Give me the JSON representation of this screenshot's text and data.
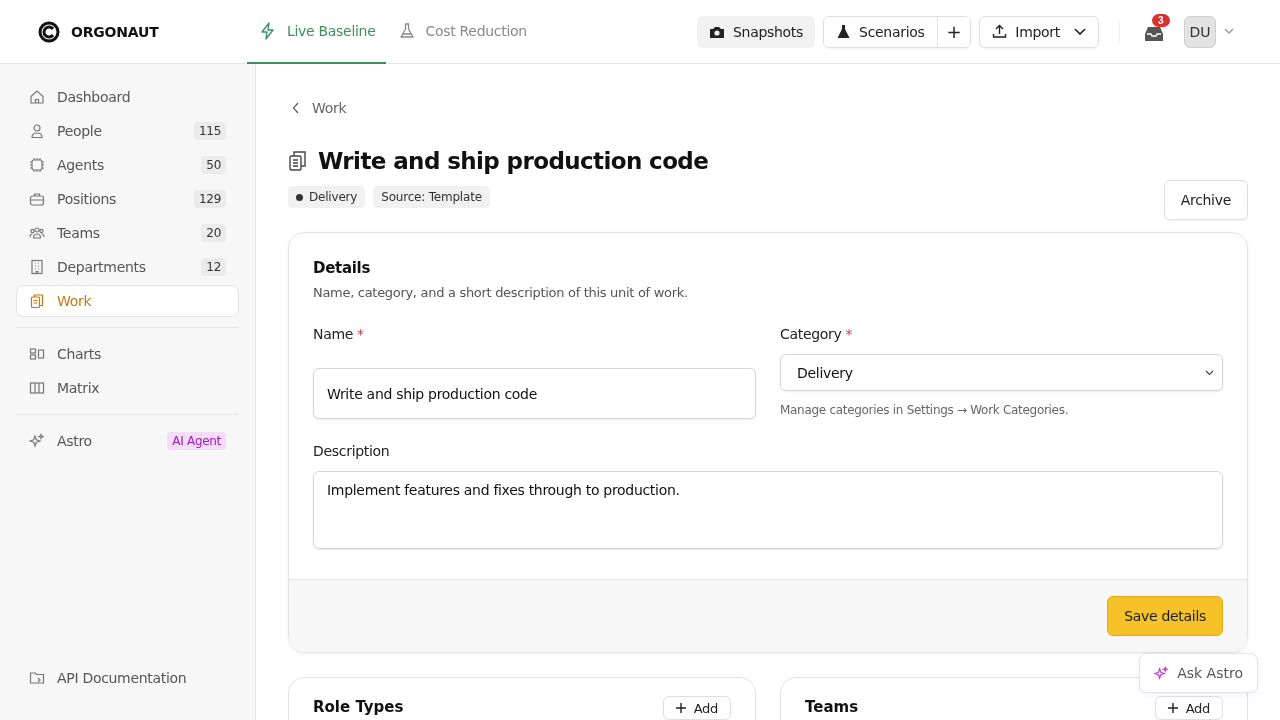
{
  "brand": {
    "name": "ORGONAUT"
  },
  "tabs": [
    {
      "label": "Live Baseline",
      "kind": "bolt",
      "selected": true
    },
    {
      "label": "Cost Reduction",
      "kind": "flask",
      "selected": false
    }
  ],
  "toolbar": {
    "snapshots": "Snapshots",
    "scenarios": "Scenarios",
    "add": "+",
    "import": "Import",
    "inbox_count": "3",
    "avatar": "DU"
  },
  "sidebar": {
    "groups": [
      [
        {
          "label": "Dashboard",
          "kind": "home",
          "selected": false
        },
        {
          "label": "People",
          "kind": "person",
          "count": "115",
          "selected": false
        },
        {
          "label": "Agents",
          "kind": "chip",
          "count": "50",
          "selected": false
        },
        {
          "label": "Positions",
          "kind": "briefcase",
          "count": "129",
          "selected": false
        },
        {
          "label": "Teams",
          "kind": "team",
          "count": "20",
          "selected": false
        },
        {
          "label": "Departments",
          "kind": "building",
          "count": "12",
          "selected": false
        },
        {
          "label": "Work",
          "kind": "clipboard",
          "selected": true
        }
      ],
      [
        {
          "label": "Charts",
          "kind": "chart",
          "selected": false
        },
        {
          "label": "Matrix",
          "kind": "columns",
          "selected": false
        }
      ],
      [
        {
          "label": "Astro",
          "kind": "sparkle",
          "tag": "AI Agent",
          "selected": false
        }
      ]
    ],
    "footer": "API Documentation"
  },
  "breadcrumb": "Work",
  "title": "Write and ship production code",
  "tags": [
    {
      "label": "Delivery",
      "color": "#333333"
    },
    {
      "label": "Source: Template"
    }
  ],
  "archive": "Archive",
  "details": {
    "title": "Details",
    "subtitle": "Name, category, and a short description of this unit of work.",
    "name": {
      "label": "Name",
      "marker": "*",
      "value": "Write and ship production code"
    },
    "category": {
      "label": "Category",
      "marker": "*",
      "value": "Delivery",
      "hint": "Manage categories in Settings → Work Categories."
    },
    "description": {
      "label": "Description",
      "value": "Implement features and fixes through to production."
    },
    "save": "Save details"
  },
  "cards": [
    {
      "title": "Role Types",
      "add": "Add"
    },
    {
      "title": "Teams",
      "add": "Add"
    }
  ],
  "ask_astro": "Ask Astro"
}
